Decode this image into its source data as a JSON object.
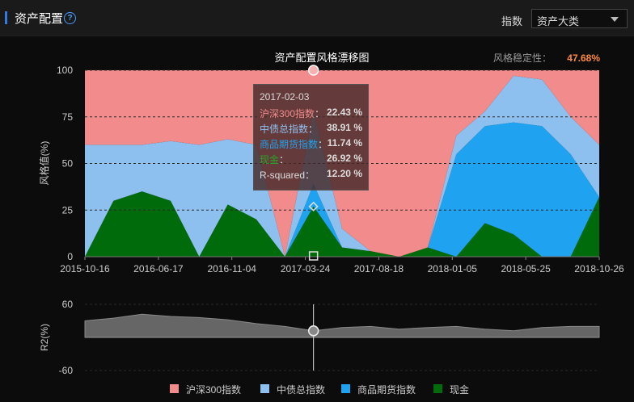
{
  "header": {
    "title": "资产配置",
    "select_label": "指数",
    "select_value": "资产大类"
  },
  "colors": {
    "hs300": "#f28b8b",
    "bond": "#8ec0ef",
    "commodity": "#1fa3f0",
    "cash": "#006b0a",
    "r2": "#666666"
  },
  "tooltip": {
    "date": "2017-02-03",
    "rows": [
      {
        "name": "沪深300指数",
        "value": "22.43 %",
        "color": "#f28b8b"
      },
      {
        "name": "中债总指数",
        "value": "38.91 %",
        "color": "#8ec0ef"
      },
      {
        "name": "商品期货指数",
        "value": "11.74 %",
        "color": "#1fa3f0"
      },
      {
        "name": "现金",
        "value": "26.92 %",
        "color": "#2aa52a"
      },
      {
        "name": "R-squared",
        "value": "12.20 %",
        "color": "#dddddd"
      }
    ]
  },
  "chart_data": [
    {
      "type": "area",
      "stacked": true,
      "title": "资产配置风格漂移图",
      "stability_label": "风格稳定性：",
      "stability_value": "47.68%",
      "ylabel": "风格值(%)",
      "ylim": [
        0,
        100
      ],
      "yticks": [
        0,
        25,
        50,
        75,
        100
      ],
      "xtick_labels": [
        "2015-10-16",
        "2016-06-17",
        "2016-11-04",
        "2017-03-24",
        "2017-08-18",
        "2018-01-05",
        "2018-05-25",
        "2018-10-26"
      ],
      "x": [
        "2015-10",
        "2015-12",
        "2016-02",
        "2016-04",
        "2016-06",
        "2016-08",
        "2016-10",
        "2016-12",
        "2017-02",
        "2017-04",
        "2017-06",
        "2017-08",
        "2017-10",
        "2017-12",
        "2018-02",
        "2018-04",
        "2018-06",
        "2018-08",
        "2018-10"
      ],
      "series": [
        {
          "name": "现金",
          "values": [
            0,
            30,
            35,
            30,
            0,
            28,
            20,
            0,
            27,
            5,
            3,
            0,
            5,
            0,
            18,
            12,
            0,
            0,
            32
          ]
        },
        {
          "name": "商品期货指数",
          "values": [
            0,
            0,
            0,
            0,
            0,
            0,
            0,
            0,
            12,
            0,
            0,
            0,
            0,
            55,
            52,
            60,
            70,
            55,
            0
          ]
        },
        {
          "name": "中债总指数",
          "values": [
            60,
            30,
            25,
            32,
            60,
            35,
            40,
            0,
            39,
            10,
            0,
            0,
            0,
            10,
            8,
            25,
            25,
            20,
            28
          ]
        },
        {
          "name": "沪深300指数",
          "values": [
            40,
            40,
            40,
            38,
            40,
            37,
            40,
            100,
            22,
            85,
            97,
            100,
            95,
            35,
            22,
            3,
            5,
            25,
            40
          ]
        }
      ]
    },
    {
      "type": "area",
      "ylabel": "R2(%)",
      "ylim": [
        -60,
        60
      ],
      "yticks": [
        -60,
        60
      ],
      "x": [
        "2015-10",
        "2015-12",
        "2016-02",
        "2016-04",
        "2016-06",
        "2016-08",
        "2016-10",
        "2016-12",
        "2017-02",
        "2017-04",
        "2017-06",
        "2017-08",
        "2017-10",
        "2017-12",
        "2018-02",
        "2018-04",
        "2018-06",
        "2018-08",
        "2018-10"
      ],
      "series": [
        {
          "name": "R-squared",
          "values": [
            30,
            35,
            42,
            38,
            36,
            32,
            25,
            20,
            12,
            18,
            20,
            15,
            18,
            20,
            15,
            12,
            18,
            20,
            20
          ]
        }
      ]
    }
  ],
  "legend": [
    {
      "name": "沪深300指数",
      "color": "#f28b8b"
    },
    {
      "name": "中债总指数",
      "color": "#8ec0ef"
    },
    {
      "name": "商品期货指数",
      "color": "#1fa3f0"
    },
    {
      "name": "现金",
      "color": "#006b0a"
    }
  ]
}
